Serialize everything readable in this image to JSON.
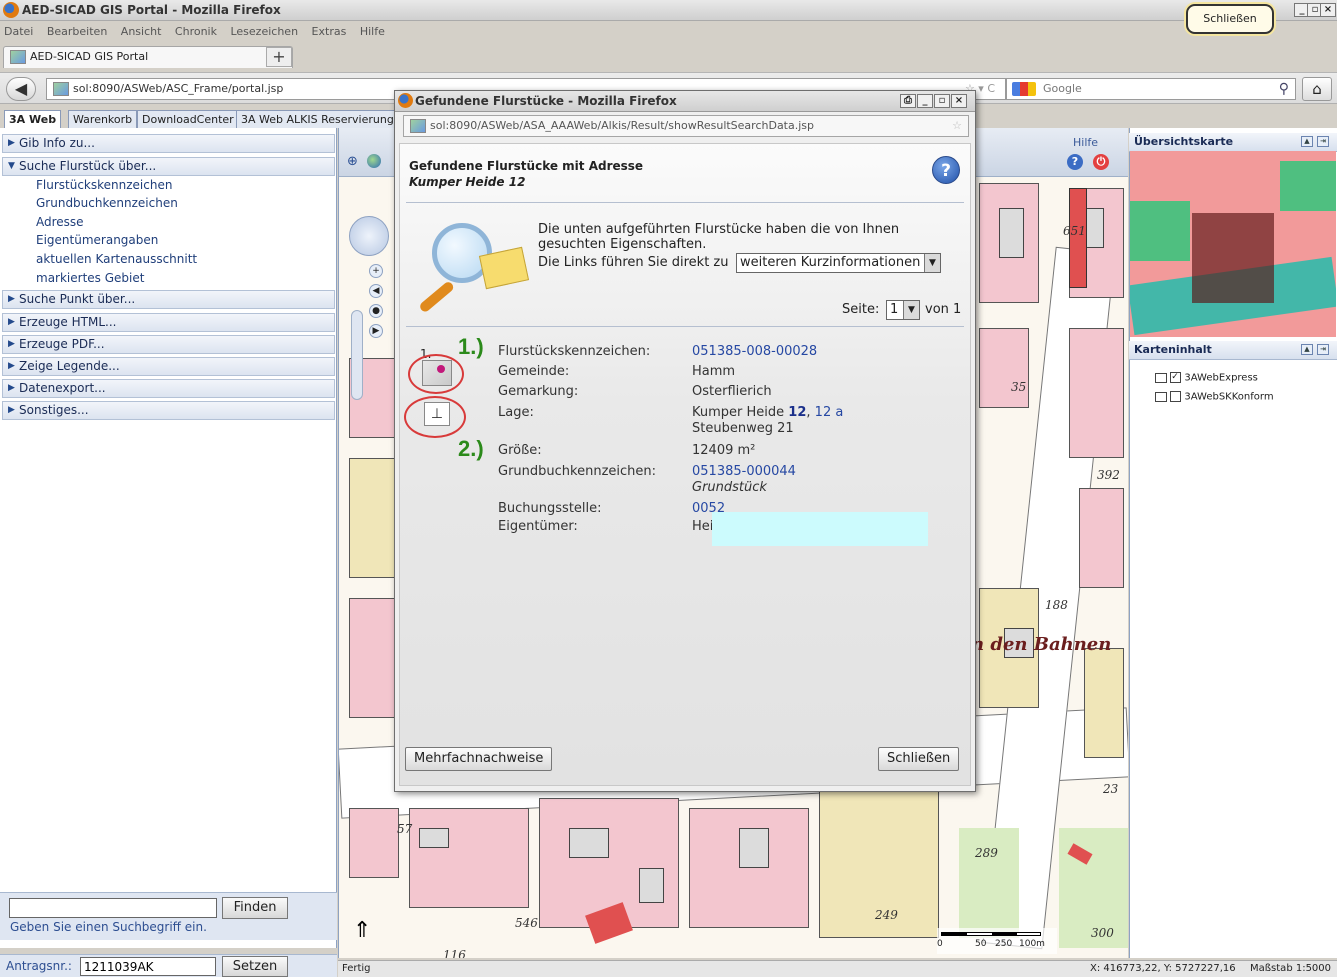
{
  "window": {
    "title": "AED-SICAD GIS Portal - Mozilla Firefox",
    "close_tooltip": "Schließen"
  },
  "menu": [
    "Datei",
    "Bearbeiten",
    "Ansicht",
    "Chronik",
    "Lesezeichen",
    "Extras",
    "Hilfe"
  ],
  "browser_tab": "AED-SICAD GIS Portal",
  "url": "sol:8090/ASWeb/ASC_Frame/portal.jsp",
  "google_placeholder": "Google",
  "app_tabs": [
    "3A Web",
    "Warenkorb",
    "DownloadCenter",
    "3A Web ALKIS Reservierung"
  ],
  "left": {
    "sections": {
      "gib_info": "Gib Info zu...",
      "suche_flurstueck": "Suche Flurstück über...",
      "suche_punkt": "Suche Punkt über...",
      "html": "Erzeuge HTML...",
      "pdf": "Erzeuge PDF...",
      "legende": "Zeige Legende...",
      "export": "Datenexport...",
      "sonstiges": "Sonstiges..."
    },
    "sub_items": [
      "Flurstückskennzeichen",
      "Grundbuchkennzeichen",
      "Adresse",
      "Eigentümerangaben",
      "aktuellen Kartenausschnitt",
      "markiertes Gebiet"
    ],
    "find_button": "Finden",
    "find_hint": "Geben Sie einen Suchbegriff ein.",
    "antrag_label": "Antragsnr.:",
    "antrag_value": "1211039AK",
    "set_button": "Setzen"
  },
  "map": {
    "help": "Hilfe",
    "labels": [
      "651",
      "35",
      "392",
      "188",
      "n den Bahnen",
      "57",
      "289",
      "546",
      "249",
      "23",
      "300",
      "116"
    ],
    "scale_labels": [
      "0",
      "50",
      "250",
      "100m"
    ]
  },
  "right": {
    "overview_title": "Übersichtskarte",
    "content_title": "Karteninhalt",
    "layers": [
      {
        "name": "3AWebExpress",
        "checked": true
      },
      {
        "name": "3AWebSKKonform",
        "checked": false
      }
    ]
  },
  "status": {
    "left": "Fertig",
    "coords": "X: 416773,22, Y: 5727227,16",
    "scale": "Maßstab 1:5000"
  },
  "popup": {
    "title": "Gefundene Flurstücke - Mozilla Firefox",
    "url": "sol:8090/ASWeb/ASA_AAAWeb/Alkis/Result/showResultSearchData.jsp",
    "heading": "Gefundene Flurstücke mit Adresse",
    "subheading": "Kumper Heide 12",
    "intro_line1": "Die unten aufgeführten Flurstücke haben die von Ihnen",
    "intro_line2": "gesuchten Eigenschaften.",
    "links_text": "Die Links führen Sie direkt zu",
    "links_select": "weiteren Kurzinformationen",
    "page_label": "Seite:",
    "page_value": "1",
    "page_of": "von 1",
    "row_number": "1.",
    "annot1": "1.)",
    "annot2": "2.)",
    "fields": {
      "fkz_label": "Flurstückskennzeichen:",
      "fkz_value": "051385-008-00028",
      "gemeinde_label": "Gemeinde:",
      "gemeinde_value": "Hamm",
      "gemarkung_label": "Gemarkung:",
      "gemarkung_value": "Osterflierich",
      "lage_label": "Lage:",
      "lage_street": "Kumper Heide",
      "lage_num1": "12",
      "lage_sep": ",",
      "lage_num2": "12 a",
      "lage_line2": "Steubenweg 21",
      "groesse_label": "Größe:",
      "groesse_value": "12409 m²",
      "gbk_label": "Grundbuchkennzeichen:",
      "gbk_value": "051385-000044",
      "gbk_sub": "Grundstück",
      "buchung_label": "Buchungsstelle:",
      "buchung_value": "0052",
      "eigentuemer_label": "Eigentümer:",
      "eigentuemer_value": "Hei"
    },
    "btn_multi": "Mehrfachnachweise",
    "btn_close": "Schließen"
  }
}
